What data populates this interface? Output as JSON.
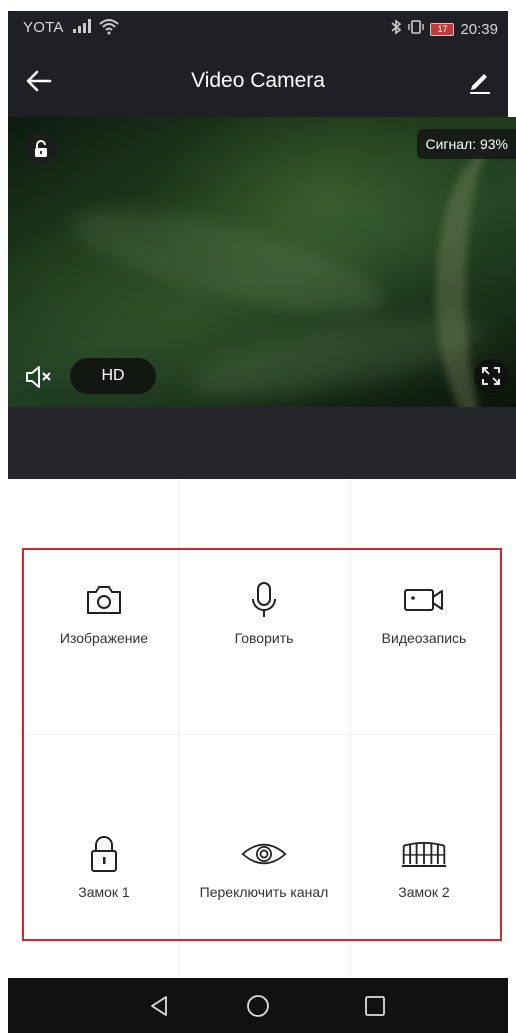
{
  "status_bar": {
    "carrier": "YOTA",
    "battery": "17",
    "time": "20:39"
  },
  "app_bar": {
    "title": "Video Camera"
  },
  "video": {
    "signal_text": "Сигнал: 93%",
    "quality_label": "HD"
  },
  "controls": {
    "items": [
      {
        "label": "Изображение",
        "icon": "camera-icon"
      },
      {
        "label": "Говорить",
        "icon": "microphone-icon"
      },
      {
        "label": "Видеозапись",
        "icon": "video-record-icon"
      },
      {
        "label": "Замок 1",
        "icon": "lock-icon"
      },
      {
        "label": "Переключить канал",
        "icon": "eye-icon"
      },
      {
        "label": "Замок 2",
        "icon": "gate-icon"
      }
    ]
  },
  "nav_bar": {
    "buttons": [
      "back-triangle-icon",
      "home-circle-icon",
      "recents-square-icon"
    ]
  },
  "colors": {
    "header_bg": "#1f1f26",
    "highlight_border": "#d9262c"
  }
}
